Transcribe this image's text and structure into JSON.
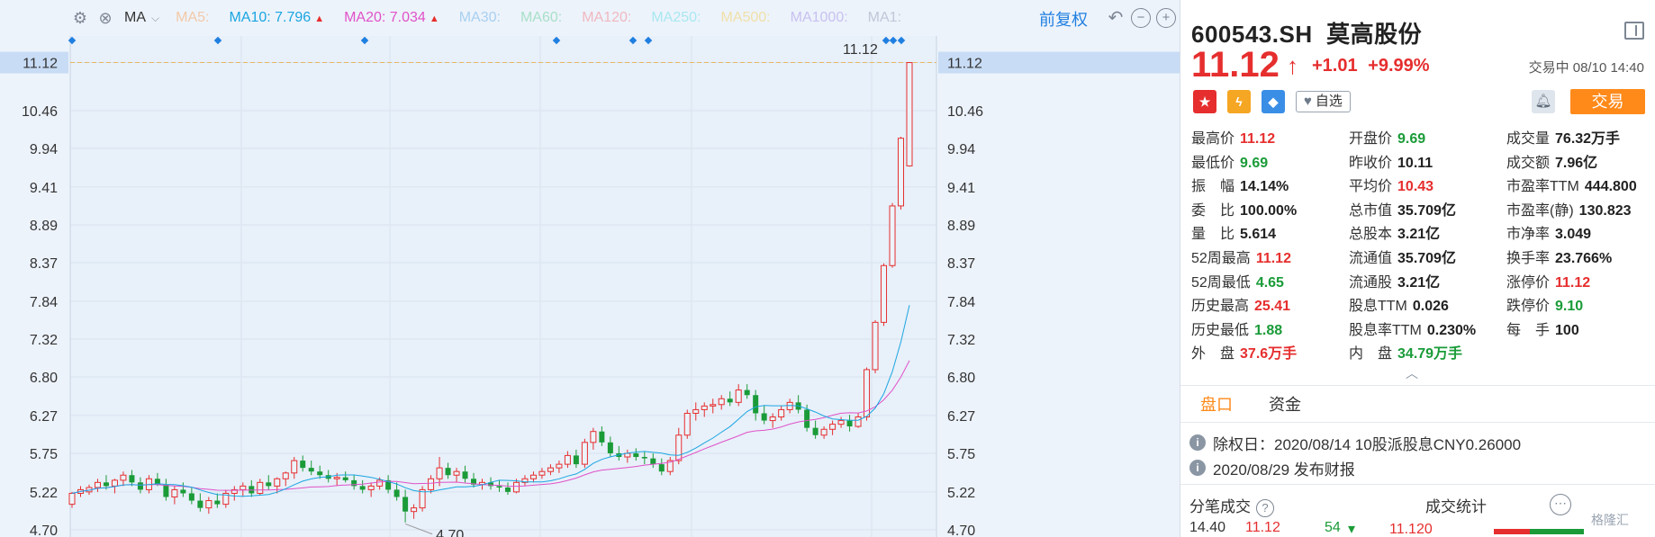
{
  "toolbar": {
    "ma_selector": "MA",
    "ma_items": [
      {
        "label": "MA5:",
        "color": "#f2c9a8",
        "arrow": false
      },
      {
        "label": "MA10: 7.796",
        "color": "#1aa6e0",
        "arrow": true
      },
      {
        "label": "MA20: 7.034",
        "color": "#e052c8",
        "arrow": true
      },
      {
        "label": "MA30:",
        "color": "#a8d0f0",
        "arrow": false
      },
      {
        "label": "MA60:",
        "color": "#a8e0c8",
        "arrow": false
      },
      {
        "label": "MA120:",
        "color": "#f0b8c0",
        "arrow": false
      },
      {
        "label": "MA250:",
        "color": "#a8e8f0",
        "arrow": false
      },
      {
        "label": "MA500:",
        "color": "#f0e0a8",
        "arrow": false
      },
      {
        "label": "MA1000:",
        "color": "#c8c0f0",
        "arrow": false
      },
      {
        "label": "MA1:",
        "color": "#c0c8d8",
        "arrow": false
      }
    ],
    "adjust_label": "前复权"
  },
  "chart_data": {
    "type": "candlestick",
    "title": "",
    "y_ticks": [
      "11.12",
      "10.46",
      "9.94",
      "9.41",
      "8.89",
      "8.37",
      "7.84",
      "7.32",
      "6.80",
      "6.27",
      "5.75",
      "5.22",
      "4.70"
    ],
    "ylim": [
      4.6,
      11.3
    ],
    "current_price_line": 11.12,
    "high_label": "11.12",
    "low_label": "4.70",
    "candles": [
      [
        5.05,
        5.22,
        5.0,
        5.2
      ],
      [
        5.2,
        5.3,
        5.15,
        5.25
      ],
      [
        5.22,
        5.32,
        5.18,
        5.28
      ],
      [
        5.28,
        5.4,
        5.22,
        5.35
      ],
      [
        5.35,
        5.45,
        5.25,
        5.3
      ],
      [
        5.3,
        5.4,
        5.2,
        5.38
      ],
      [
        5.38,
        5.5,
        5.3,
        5.45
      ],
      [
        5.45,
        5.52,
        5.3,
        5.35
      ],
      [
        5.35,
        5.42,
        5.2,
        5.25
      ],
      [
        5.25,
        5.45,
        5.2,
        5.4
      ],
      [
        5.4,
        5.48,
        5.3,
        5.32
      ],
      [
        5.32,
        5.4,
        5.1,
        5.15
      ],
      [
        5.15,
        5.3,
        5.05,
        5.25
      ],
      [
        5.25,
        5.35,
        5.15,
        5.2
      ],
      [
        5.2,
        5.28,
        5.05,
        5.1
      ],
      [
        5.1,
        5.2,
        4.95,
        5.0
      ],
      [
        5.0,
        5.15,
        4.92,
        5.1
      ],
      [
        5.1,
        5.2,
        5.0,
        5.05
      ],
      [
        5.05,
        5.25,
        5.0,
        5.2
      ],
      [
        5.2,
        5.3,
        5.1,
        5.25
      ],
      [
        5.25,
        5.35,
        5.15,
        5.3
      ],
      [
        5.3,
        5.38,
        5.15,
        5.2
      ],
      [
        5.2,
        5.4,
        5.18,
        5.35
      ],
      [
        5.35,
        5.45,
        5.25,
        5.3
      ],
      [
        5.3,
        5.42,
        5.2,
        5.4
      ],
      [
        5.4,
        5.5,
        5.3,
        5.48
      ],
      [
        5.48,
        5.7,
        5.4,
        5.65
      ],
      [
        5.65,
        5.72,
        5.5,
        5.55
      ],
      [
        5.55,
        5.65,
        5.45,
        5.5
      ],
      [
        5.5,
        5.58,
        5.4,
        5.45
      ],
      [
        5.45,
        5.52,
        5.35,
        5.4
      ],
      [
        5.4,
        5.48,
        5.3,
        5.42
      ],
      [
        5.42,
        5.5,
        5.35,
        5.38
      ],
      [
        5.38,
        5.45,
        5.25,
        5.3
      ],
      [
        5.3,
        5.38,
        5.2,
        5.25
      ],
      [
        5.25,
        5.35,
        5.15,
        5.3
      ],
      [
        5.3,
        5.42,
        5.25,
        5.38
      ],
      [
        5.38,
        5.45,
        5.2,
        5.25
      ],
      [
        5.25,
        5.35,
        5.1,
        5.15
      ],
      [
        5.15,
        5.25,
        4.8,
        4.95
      ],
      [
        4.95,
        5.05,
        4.85,
        5.0
      ],
      [
        5.0,
        5.3,
        4.95,
        5.25
      ],
      [
        5.25,
        5.45,
        5.2,
        5.4
      ],
      [
        5.4,
        5.7,
        5.3,
        5.55
      ],
      [
        5.55,
        5.62,
        5.4,
        5.45
      ],
      [
        5.45,
        5.55,
        5.35,
        5.5
      ],
      [
        5.5,
        5.58,
        5.35,
        5.4
      ],
      [
        5.4,
        5.48,
        5.28,
        5.32
      ],
      [
        5.32,
        5.4,
        5.25,
        5.35
      ],
      [
        5.35,
        5.42,
        5.25,
        5.3
      ],
      [
        5.3,
        5.38,
        5.22,
        5.28
      ],
      [
        5.28,
        5.35,
        5.18,
        5.22
      ],
      [
        5.22,
        5.4,
        5.2,
        5.35
      ],
      [
        5.35,
        5.45,
        5.3,
        5.4
      ],
      [
        5.4,
        5.5,
        5.35,
        5.45
      ],
      [
        5.45,
        5.55,
        5.4,
        5.5
      ],
      [
        5.5,
        5.6,
        5.45,
        5.55
      ],
      [
        5.55,
        5.65,
        5.48,
        5.6
      ],
      [
        5.6,
        5.78,
        5.55,
        5.72
      ],
      [
        5.72,
        5.8,
        5.55,
        5.6
      ],
      [
        5.6,
        5.95,
        5.55,
        5.9
      ],
      [
        5.9,
        6.1,
        5.8,
        6.05
      ],
      [
        6.05,
        6.12,
        5.85,
        5.9
      ],
      [
        5.9,
        5.98,
        5.7,
        5.75
      ],
      [
        5.75,
        5.85,
        5.65,
        5.7
      ],
      [
        5.7,
        5.8,
        5.62,
        5.75
      ],
      [
        5.75,
        5.82,
        5.65,
        5.7
      ],
      [
        5.7,
        5.78,
        5.6,
        5.68
      ],
      [
        5.68,
        5.75,
        5.55,
        5.6
      ],
      [
        5.6,
        5.68,
        5.45,
        5.5
      ],
      [
        5.5,
        5.7,
        5.45,
        5.65
      ],
      [
        5.65,
        6.1,
        5.6,
        6.0
      ],
      [
        6.0,
        6.35,
        5.95,
        6.3
      ],
      [
        6.3,
        6.45,
        6.2,
        6.35
      ],
      [
        6.35,
        6.45,
        6.25,
        6.4
      ],
      [
        6.4,
        6.5,
        6.3,
        6.42
      ],
      [
        6.42,
        6.55,
        6.35,
        6.5
      ],
      [
        6.5,
        6.6,
        6.4,
        6.45
      ],
      [
        6.45,
        6.7,
        6.4,
        6.62
      ],
      [
        6.62,
        6.7,
        6.5,
        6.55
      ],
      [
        6.55,
        6.62,
        6.2,
        6.3
      ],
      [
        6.3,
        6.4,
        6.15,
        6.2
      ],
      [
        6.2,
        6.3,
        6.1,
        6.25
      ],
      [
        6.25,
        6.4,
        6.2,
        6.35
      ],
      [
        6.35,
        6.5,
        6.3,
        6.45
      ],
      [
        6.45,
        6.55,
        6.3,
        6.35
      ],
      [
        6.35,
        6.42,
        6.05,
        6.1
      ],
      [
        6.1,
        6.2,
        5.95,
        6.0
      ],
      [
        6.0,
        6.12,
        5.95,
        6.08
      ],
      [
        6.08,
        6.2,
        6.0,
        6.15
      ],
      [
        6.15,
        6.25,
        6.1,
        6.2
      ],
      [
        6.2,
        6.28,
        6.05,
        6.12
      ],
      [
        6.12,
        6.3,
        6.1,
        6.25
      ],
      [
        6.25,
        6.93,
        6.2,
        6.9
      ],
      [
        6.9,
        7.58,
        6.85,
        7.55
      ],
      [
        7.55,
        8.36,
        7.5,
        8.33
      ],
      [
        8.33,
        9.19,
        8.3,
        9.15
      ],
      [
        9.15,
        10.1,
        9.1,
        10.08
      ],
      [
        9.7,
        11.12,
        9.69,
        11.12
      ]
    ],
    "ma10_color": "#1aa6e0",
    "ma20_color": "#e052c8",
    "up_color": "#e62e2e",
    "down_color": "#1a9b38",
    "event_markers": [
      80,
      242,
      405,
      618,
      703,
      720,
      984,
      992,
      1001
    ]
  },
  "panel": {
    "code": "600543.SH",
    "name": "莫高股份",
    "price": "11.12",
    "change": "+1.01",
    "change_pct": "+9.99%",
    "status": "交易中 08/10 14:40",
    "fav_label": "自选",
    "trade_label": "交易",
    "stats": [
      [
        {
          "l": "最高价",
          "v": "11.12",
          "c": "red"
        },
        {
          "l": "开盘价",
          "v": "9.69",
          "c": "green"
        },
        {
          "l": "成交量",
          "v": "76.32万手",
          "c": "dark"
        }
      ],
      [
        {
          "l": "最低价",
          "v": "9.69",
          "c": "green"
        },
        {
          "l": "昨收价",
          "v": "10.11",
          "c": "dark"
        },
        {
          "l": "成交额",
          "v": "7.96亿",
          "c": "dark"
        }
      ],
      [
        {
          "l": "振　幅",
          "v": "14.14%",
          "c": "dark"
        },
        {
          "l": "平均价",
          "v": "10.43",
          "c": "red"
        },
        {
          "l": "市盈率TTM",
          "v": "444.800",
          "c": "dark"
        }
      ],
      [
        {
          "l": "委　比",
          "v": "100.00%",
          "c": "dark"
        },
        {
          "l": "总市值",
          "v": "35.709亿",
          "c": "dark"
        },
        {
          "l": "市盈率(静)",
          "v": "130.823",
          "c": "dark"
        }
      ],
      [
        {
          "l": "量　比",
          "v": "5.614",
          "c": "dark"
        },
        {
          "l": "总股本",
          "v": "3.21亿",
          "c": "dark"
        },
        {
          "l": "市净率",
          "v": "3.049",
          "c": "dark"
        }
      ],
      [
        {
          "l": "52周最高",
          "v": "11.12",
          "c": "red"
        },
        {
          "l": "流通值",
          "v": "35.709亿",
          "c": "dark"
        },
        {
          "l": "换手率",
          "v": "23.766%",
          "c": "dark"
        }
      ],
      [
        {
          "l": "52周最低",
          "v": "4.65",
          "c": "green"
        },
        {
          "l": "流通股",
          "v": "3.21亿",
          "c": "dark"
        },
        {
          "l": "涨停价",
          "v": "11.12",
          "c": "red"
        }
      ],
      [
        {
          "l": "历史最高",
          "v": "25.41",
          "c": "red"
        },
        {
          "l": "股息TTM",
          "v": "0.026",
          "c": "dark"
        },
        {
          "l": "跌停价",
          "v": "9.10",
          "c": "green"
        }
      ],
      [
        {
          "l": "历史最低",
          "v": "1.88",
          "c": "green"
        },
        {
          "l": "股息率TTM",
          "v": "0.230%",
          "c": "dark"
        },
        {
          "l": "每　手",
          "v": "100",
          "c": "dark"
        }
      ],
      [
        {
          "l": "外　盘",
          "v": "37.6万手",
          "c": "red"
        },
        {
          "l": "内　盘",
          "v": "34.79万手",
          "c": "green"
        },
        {
          "l": "",
          "v": "",
          "c": "dark"
        }
      ]
    ],
    "tabs": [
      "盘口",
      "资金"
    ],
    "events": [
      "除权日：2020/08/14  10股派股息CNY0.26000",
      "2020/08/29  发布财报"
    ],
    "bottom_left": "分笔成交",
    "bottom_right": "成交统计",
    "tick_row": {
      "time": "14.40",
      "price": "11.12",
      "vol": "54",
      "stat_price": "11.120"
    },
    "watermark": "格隆汇"
  }
}
